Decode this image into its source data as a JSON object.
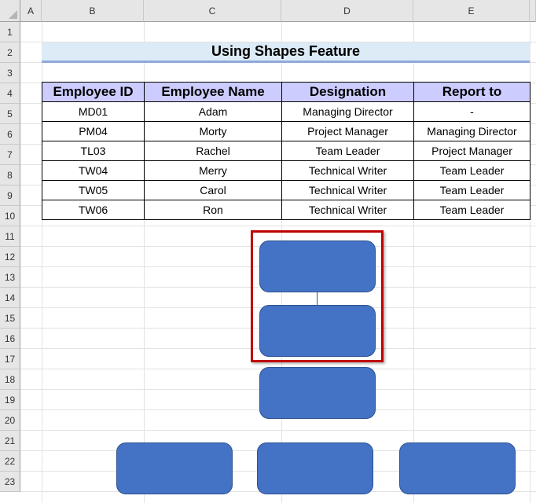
{
  "columns": [
    "A",
    "B",
    "C",
    "D",
    "E"
  ],
  "rows": [
    "1",
    "2",
    "3",
    "4",
    "5",
    "6",
    "7",
    "8",
    "9",
    "10",
    "11",
    "12",
    "13",
    "14",
    "15",
    "16",
    "17",
    "18",
    "19",
    "20",
    "21",
    "22",
    "23"
  ],
  "title": "Using Shapes Feature",
  "table": {
    "headers": [
      "Employee ID",
      "Employee Name",
      "Designation",
      "Report to"
    ],
    "rows": [
      [
        "MD01",
        "Adam",
        "Managing Director",
        "-"
      ],
      [
        "PM04",
        "Morty",
        "Project Manager",
        "Managing Director"
      ],
      [
        "TL03",
        "Rachel",
        "Team Leader",
        "Project Manager"
      ],
      [
        "TW04",
        "Merry",
        "Technical Writer",
        "Team Leader"
      ],
      [
        "TW05",
        "Carol",
        "Technical Writer",
        "Team Leader"
      ],
      [
        "TW06",
        "Ron",
        "Technical Writer",
        "Team Leader"
      ]
    ]
  },
  "colors": {
    "shape_fill": "#4472c4",
    "highlight": "#c00000",
    "header_fill": "#ccccff",
    "title_fill": "#ddebf7"
  }
}
